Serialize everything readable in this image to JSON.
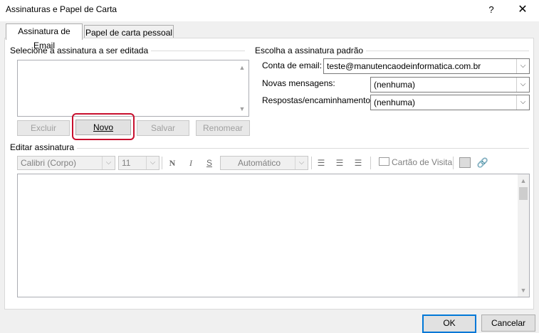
{
  "window": {
    "title": "Assinaturas e Papel de Carta",
    "help_label": "?",
    "close_label": "✕"
  },
  "tabs": [
    {
      "label": "Assinatura de Email"
    },
    {
      "label": "Papel de carta pessoal"
    }
  ],
  "select_section": {
    "heading": "Selecione a assinatura a ser editada",
    "buttons": {
      "delete": "Excluir",
      "new": "Novo",
      "save": "Salvar",
      "rename": "Renomear"
    }
  },
  "default_section": {
    "heading": "Escolha a assinatura padrão",
    "account_label": "Conta de email:",
    "account_value": "teste@manutencaodeinformatica.com.br",
    "new_messages_label": "Novas mensagens:",
    "new_messages_value": "(nenhuma)",
    "replies_label": "Respostas/encaminhamentos:",
    "replies_value": "(nenhuma)"
  },
  "edit_section": {
    "heading": "Editar assinatura",
    "font": "Calibri (Corpo)",
    "size": "11",
    "bold": "N",
    "italic": "I",
    "underline": "S",
    "color": "Automático",
    "business_card": "Cartão de Visita"
  },
  "footer": {
    "ok": "OK",
    "cancel": "Cancelar"
  },
  "colors": {
    "accent": "#0078d7",
    "highlight": "#c8102e"
  }
}
